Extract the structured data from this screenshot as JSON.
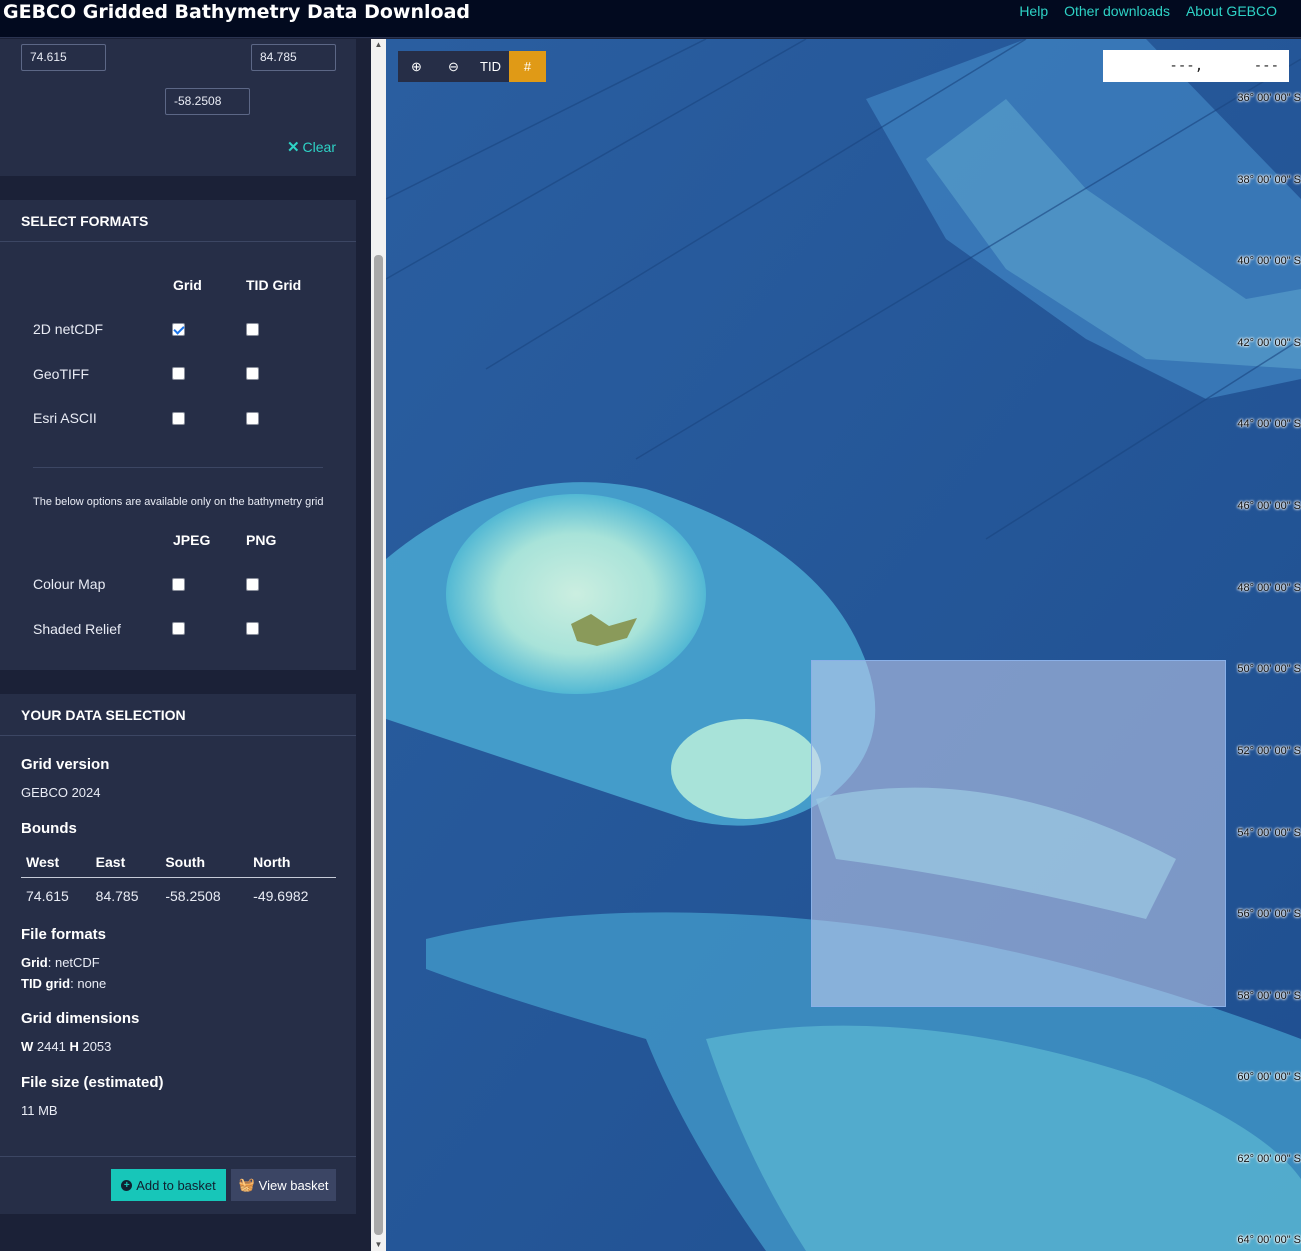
{
  "header": {
    "title": "GEBCO Gridded Bathymetry Data Download",
    "nav": [
      "Help",
      "Other downloads",
      "About GEBCO"
    ]
  },
  "coords_panel": {
    "west": "74.615",
    "east": "84.785",
    "south": "-58.2508",
    "clear_label": "Clear"
  },
  "formats": {
    "title": "SELECT FORMATS",
    "col_grid": "Grid",
    "col_tid": "TID Grid",
    "rows": [
      {
        "label": "2D netCDF",
        "grid": true,
        "tid": false
      },
      {
        "label": "GeoTIFF",
        "grid": false,
        "tid": false
      },
      {
        "label": "Esri ASCII",
        "grid": false,
        "tid": false
      }
    ],
    "note": "The below options are available only on the bathymetry grid",
    "col_jpeg": "JPEG",
    "col_png": "PNG",
    "image_rows": [
      {
        "label": "Colour Map",
        "jpeg": false,
        "png": false
      },
      {
        "label": "Shaded Relief",
        "jpeg": false,
        "png": false
      }
    ]
  },
  "selection": {
    "title": "YOUR DATA SELECTION",
    "grid_version_h": "Grid version",
    "grid_version": "GEBCO 2024",
    "bounds_h": "Bounds",
    "bounds_cols": [
      "West",
      "East",
      "South",
      "North"
    ],
    "bounds_vals": [
      "74.615",
      "84.785",
      "-58.2508",
      "-49.6982"
    ],
    "file_formats_h": "File formats",
    "grid_label": "Grid",
    "grid_value": ": netCDF",
    "tid_label": "TID grid",
    "tid_value": ": none",
    "dims_h": "Grid dimensions",
    "dims_w_label": "W",
    "dims_w": "2441",
    "dims_h_label": "H",
    "dims_h_val": "2053",
    "size_h": "File size (estimated)",
    "size": "11 MB",
    "add_label": "Add to basket",
    "view_label": "View basket"
  },
  "map": {
    "toolbar": {
      "tid_label": "TID"
    },
    "coord_readout": "---,      ---",
    "lat_labels": [
      "36° 00' 00\" S",
      "38° 00' 00\" S",
      "40° 00' 00\" S",
      "42° 00' 00\" S",
      "44° 00' 00\" S",
      "46° 00' 00\" S",
      "48° 00' 00\" S",
      "50° 00' 00\" S",
      "52° 00' 00\" S",
      "54° 00' 00\" S",
      "56° 00' 00\" S",
      "58° 00' 00\" S",
      "60° 00' 00\" S",
      "62° 00' 00\" S",
      "64° 00' 00\" S"
    ]
  },
  "colors": {
    "accent": "#2ed3c6",
    "active_tool": "#e09a16",
    "header_bg": "#020a1f",
    "panel_bg": "#262e47"
  }
}
